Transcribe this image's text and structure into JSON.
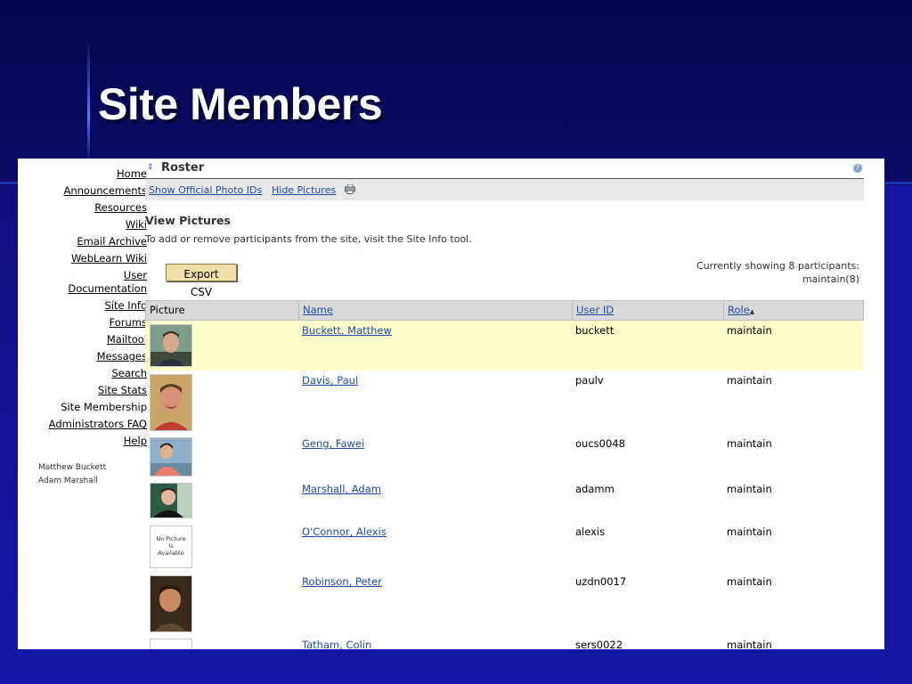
{
  "slide": {
    "title": "Site Members"
  },
  "nav": {
    "items": [
      {
        "label": "Home"
      },
      {
        "label": "Announcements"
      },
      {
        "label": "Resources"
      },
      {
        "label": "Wiki"
      },
      {
        "label": "Email Archive"
      },
      {
        "label": "WebLearn Wiki"
      },
      {
        "label": "User"
      },
      {
        "label": "Documentation"
      },
      {
        "label": "Site Info"
      },
      {
        "label": "Forums"
      },
      {
        "label": "Mailtool"
      },
      {
        "label": "Messages"
      },
      {
        "label": "Search"
      },
      {
        "label": "Site Stats"
      },
      {
        "label": "Site Membership"
      },
      {
        "label": "Administrators FAQ"
      },
      {
        "label": "Help"
      }
    ],
    "present_users": [
      "Matthew Buckett",
      "Adam Marshall"
    ]
  },
  "tool": {
    "title": "Roster",
    "help_icon": "?",
    "actions": {
      "show_photo_ids": "Show Official Photo IDs",
      "hide_pictures": "Hide Pictures",
      "print_icon": "printer-icon"
    },
    "section_heading": "View Pictures",
    "instructions": "To add or remove participants from the site, visit the Site Info tool.",
    "export_label": "Export CSV",
    "showing_line1": "Currently showing 8 participants:",
    "showing_line2": "maintain(8)"
  },
  "table": {
    "headers": {
      "picture": "Picture",
      "name": "Name",
      "user_id": "User ID",
      "role": "Role"
    },
    "sort_indicator": "▲",
    "no_picture_text": [
      "No Picture",
      "is",
      "Available"
    ],
    "rows": [
      {
        "name": "Buckett, Matthew",
        "user_id": "buckett",
        "role": "maintain"
      },
      {
        "name": "Davis, Paul",
        "user_id": "paulv",
        "role": "maintain"
      },
      {
        "name": "Geng, Fawei",
        "user_id": "oucs0048",
        "role": "maintain"
      },
      {
        "name": "Marshall, Adam",
        "user_id": "adamm",
        "role": "maintain"
      },
      {
        "name": "O'Connor, Alexis",
        "user_id": "alexis",
        "role": "maintain"
      },
      {
        "name": "Robinson, Peter",
        "user_id": "uzdn0017",
        "role": "maintain"
      },
      {
        "name": "Tatham, Colin",
        "user_id": "sers0022",
        "role": "maintain"
      }
    ]
  },
  "colors": {
    "slide_bg": "#0b0b6e",
    "link": "#1f4ea8",
    "highlight_row": "#fdfdc9",
    "button": "#f0e0a8"
  }
}
